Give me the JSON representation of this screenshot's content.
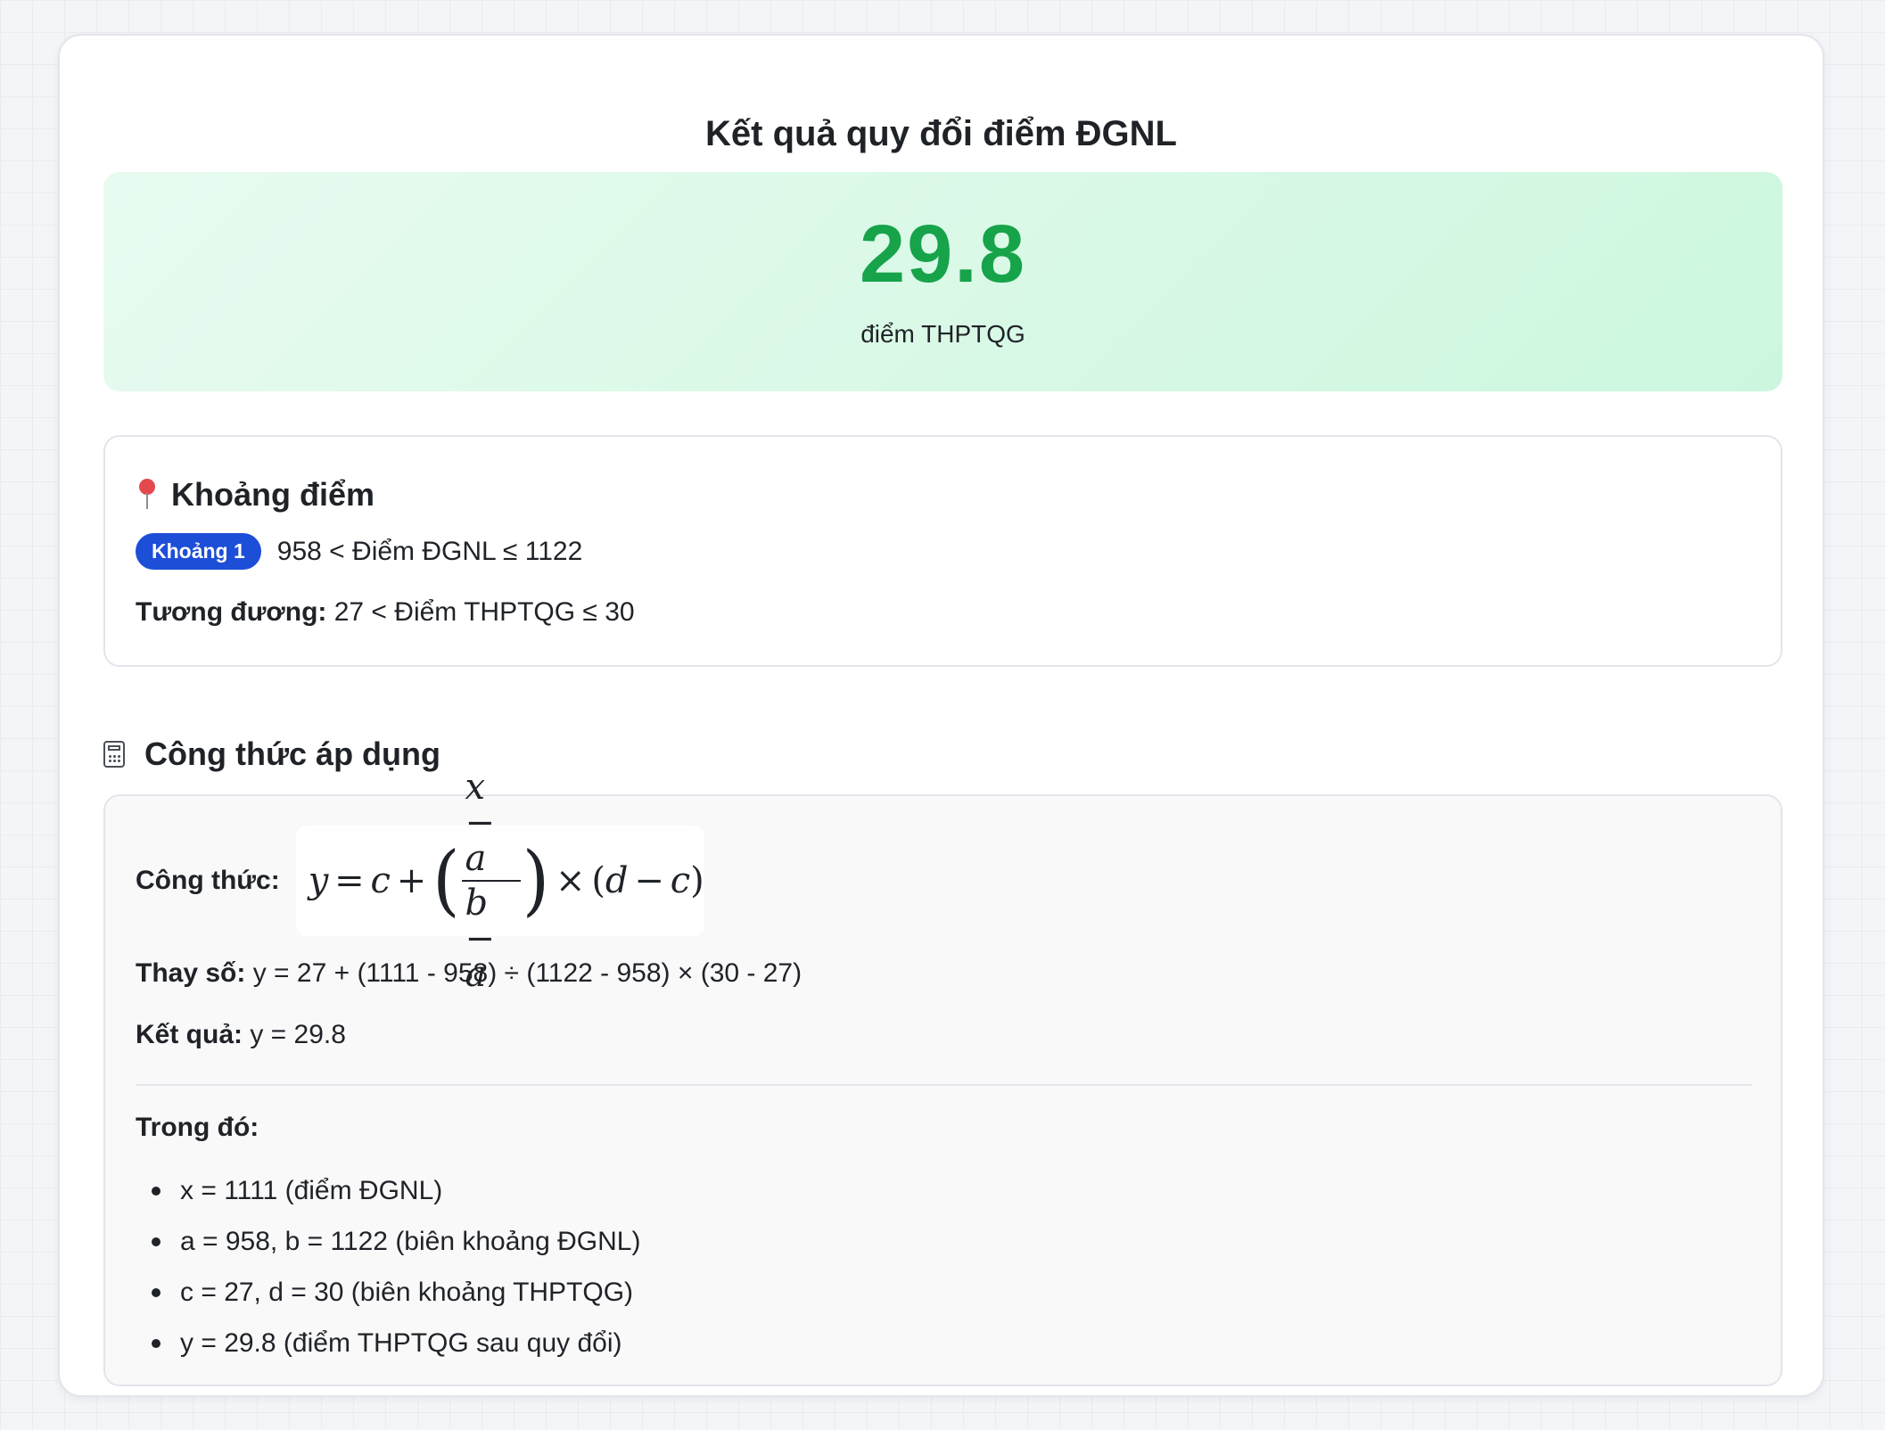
{
  "title": "Kết quả quy đổi điểm ĐGNL",
  "result": {
    "value": "29.8",
    "unit": "điểm THPTQG"
  },
  "range": {
    "heading": "Khoảng điểm",
    "badge": "Khoảng 1",
    "dgnl_range": "958 < Điểm ĐGNL ≤ 1122",
    "equiv_label": "Tương đương:",
    "equiv_value": " 27 < Điểm THPTQG ≤ 30"
  },
  "formula": {
    "heading": "Công thức áp dụng",
    "label": "Công thức:",
    "subst_label": "Thay số:",
    "subst_value": " y = 27 + (1111 - 958) ÷ (1122 - 958) × (30 - 27)",
    "result_label": "Kết quả:",
    "result_value": " y = 29.8",
    "where_label": "Trong đó:",
    "variables": [
      "x = 1111 (điểm ĐGNL)",
      "a = 958, b = 1122 (biên khoảng ĐGNL)",
      "c = 27, d = 30 (biên khoảng THPTQG)",
      "y = 29.8 (điểm THPTQG sau quy đổi)"
    ]
  },
  "colors": {
    "accent_green": "#16a34a",
    "badge_blue": "#1d4ed8"
  },
  "icons": {
    "range": "pushpin-icon",
    "formula": "calculator-icon"
  }
}
